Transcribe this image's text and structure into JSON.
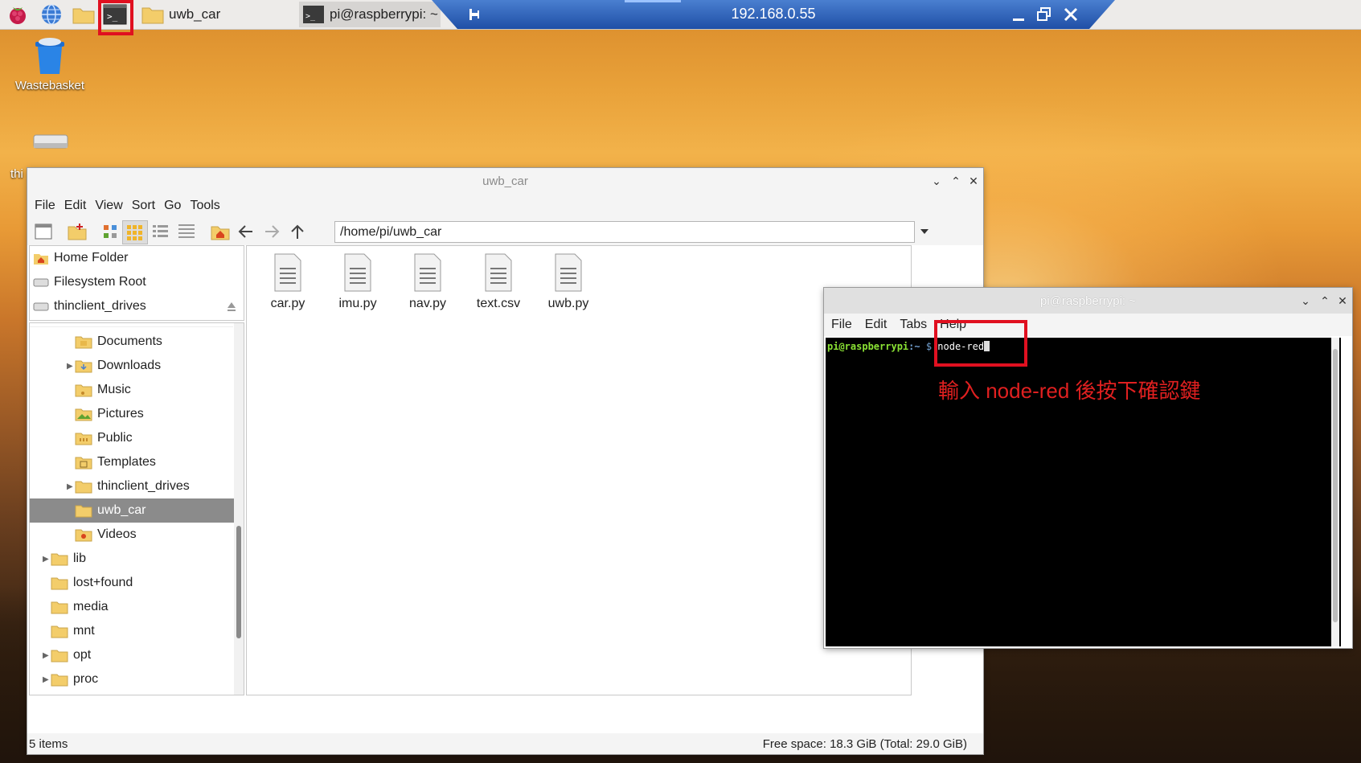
{
  "taskbar": {
    "tasks": [
      {
        "label": "uwb_car"
      },
      {
        "label": "pi@raspberrypi: ~"
      }
    ]
  },
  "remote_bar": {
    "title": "192.168.0.55"
  },
  "desktop": {
    "wastebasket_label": "Wastebasket",
    "drive_label": "thi"
  },
  "file_manager": {
    "title": "uwb_car",
    "menu": [
      "File",
      "Edit",
      "View",
      "Sort",
      "Go",
      "Tools"
    ],
    "path": "/home/pi/uwb_car",
    "places": [
      "Home Folder",
      "Filesystem Root",
      "thinclient_drives"
    ],
    "tree": [
      {
        "label": "Documents",
        "expander": ""
      },
      {
        "label": "Downloads",
        "expander": "▶"
      },
      {
        "label": "Music",
        "expander": ""
      },
      {
        "label": "Pictures",
        "expander": ""
      },
      {
        "label": "Public",
        "expander": ""
      },
      {
        "label": "Templates",
        "expander": ""
      },
      {
        "label": "thinclient_drives",
        "expander": "▶"
      },
      {
        "label": "uwb_car",
        "expander": ""
      },
      {
        "label": "Videos",
        "expander": ""
      },
      {
        "label": "lib",
        "expander": "▶"
      },
      {
        "label": "lost+found",
        "expander": ""
      },
      {
        "label": "media",
        "expander": ""
      },
      {
        "label": "mnt",
        "expander": ""
      },
      {
        "label": "opt",
        "expander": "▶"
      },
      {
        "label": "proc",
        "expander": "▶"
      }
    ],
    "files": [
      "car.py",
      "imu.py",
      "nav.py",
      "text.csv",
      "uwb.py"
    ],
    "status_left": "5 items",
    "status_right": "Free space: 18.3 GiB (Total: 29.0 GiB)"
  },
  "terminal": {
    "title": "pi@raspberrypi: ~",
    "menu": [
      "File",
      "Edit",
      "Tabs",
      "Help"
    ],
    "prompt_user": "pi@raspberrypi",
    "prompt_path": ":~",
    "prompt_symbol": " $",
    "command": " node-red",
    "annotation": "輸入 node-red 後按下確認鍵"
  },
  "colors": {
    "accent_red": "#e01020",
    "prompt_green": "#8ae234",
    "prompt_blue": "#729fcf"
  }
}
